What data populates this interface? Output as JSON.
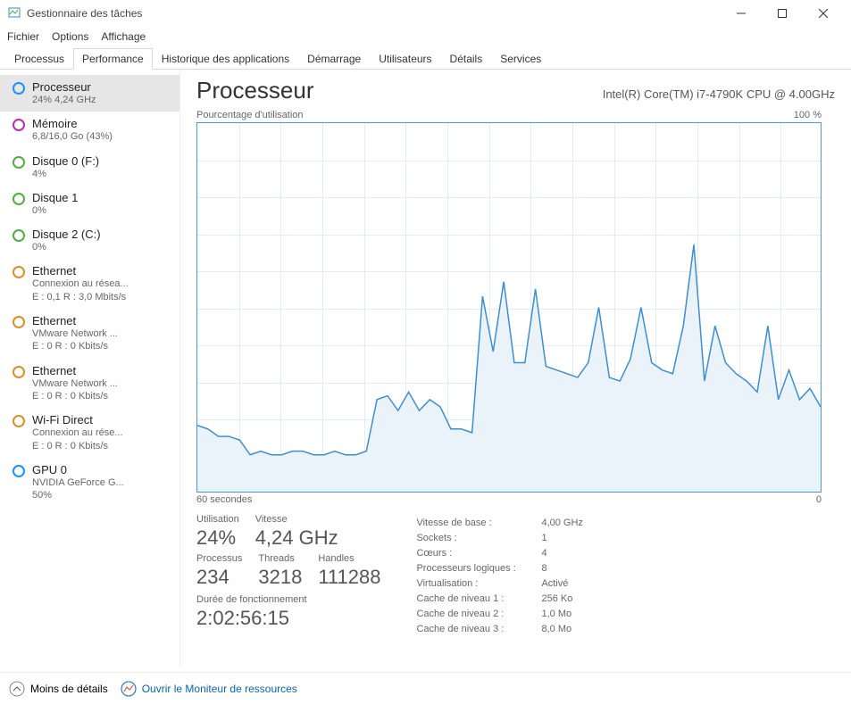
{
  "window": {
    "title": "Gestionnaire des tâches"
  },
  "menu": {
    "file": "Fichier",
    "options": "Options",
    "view": "Affichage"
  },
  "tabs": {
    "processes": "Processus",
    "performance": "Performance",
    "app_history": "Historique des applications",
    "startup": "Démarrage",
    "users": "Utilisateurs",
    "details": "Détails",
    "services": "Services"
  },
  "sidebar": [
    {
      "color": "#1e90ff",
      "title": "Processeur",
      "sub1": "24%  4,24 GHz",
      "sub2": ""
    },
    {
      "color": "#b030b0",
      "title": "Mémoire",
      "sub1": "6,8/16,0 Go (43%)",
      "sub2": ""
    },
    {
      "color": "#55aa44",
      "title": "Disque 0 (F:)",
      "sub1": "4%",
      "sub2": ""
    },
    {
      "color": "#55aa44",
      "title": "Disque 1",
      "sub1": "0%",
      "sub2": ""
    },
    {
      "color": "#55aa44",
      "title": "Disque 2 (C:)",
      "sub1": "0%",
      "sub2": ""
    },
    {
      "color": "#d98e2e",
      "title": "Ethernet",
      "sub1": "Connexion au résea...",
      "sub2": "E : 0,1 R : 3,0 Mbits/s"
    },
    {
      "color": "#d98e2e",
      "title": "Ethernet",
      "sub1": "VMware Network ...",
      "sub2": "E : 0 R : 0 Kbits/s"
    },
    {
      "color": "#d98e2e",
      "title": "Ethernet",
      "sub1": "VMware Network ...",
      "sub2": "E : 0 R : 0 Kbits/s"
    },
    {
      "color": "#d98e2e",
      "title": "Wi-Fi Direct",
      "sub1": "Connexion au rése...",
      "sub2": "E : 0 R : 0 Kbits/s"
    },
    {
      "color": "#1e90ff",
      "title": "GPU 0",
      "sub1": "NVIDIA GeForce G...",
      "sub2": "50%"
    }
  ],
  "main": {
    "heading": "Processeur",
    "model": "Intel(R) Core(TM) i7-4790K CPU @ 4.00GHz",
    "chart_top_left": "Pourcentage d'utilisation",
    "chart_top_right": "100 %",
    "chart_bottom_left": "60 secondes",
    "chart_bottom_right": "0"
  },
  "stats": {
    "utilisation_lbl": "Utilisation",
    "utilisation_val": "24%",
    "vitesse_lbl": "Vitesse",
    "vitesse_val": "4,24 GHz",
    "processus_lbl": "Processus",
    "processus_val": "234",
    "threads_lbl": "Threads",
    "threads_val": "3218",
    "handles_lbl": "Handles",
    "handles_val": "111288",
    "uptime_lbl": "Durée de fonctionnement",
    "uptime_val": "2:02:56:15"
  },
  "details": {
    "base_k": "Vitesse de base :",
    "base_v": "4,00 GHz",
    "sockets_k": "Sockets :",
    "sockets_v": "1",
    "cores_k": "Cœurs :",
    "cores_v": "4",
    "logical_k": "Processeurs logiques :",
    "logical_v": "8",
    "virt_k": "Virtualisation :",
    "virt_v": "Activé",
    "l1_k": "Cache de niveau 1 :",
    "l1_v": "256 Ko",
    "l2_k": "Cache de niveau 2 :",
    "l2_v": "1,0 Mo",
    "l3_k": "Cache de niveau 3 :",
    "l3_v": "8,0 Mo"
  },
  "footer": {
    "less": "Moins de détails",
    "resmon": "Ouvrir le Moniteur de ressources"
  },
  "chart_data": {
    "type": "area",
    "title": "Pourcentage d'utilisation",
    "xlabel": "60 secondes → 0",
    "ylabel": "%",
    "ylim": [
      0,
      100
    ],
    "x": [
      0,
      1,
      2,
      3,
      4,
      5,
      6,
      7,
      8,
      9,
      10,
      11,
      12,
      13,
      14,
      15,
      16,
      17,
      18,
      19,
      20,
      21,
      22,
      23,
      24,
      25,
      26,
      27,
      28,
      29,
      30,
      31,
      32,
      33,
      34,
      35,
      36,
      37,
      38,
      39,
      40,
      41,
      42,
      43,
      44,
      45,
      46,
      47,
      48,
      49,
      50,
      51,
      52,
      53,
      54,
      55,
      56,
      57,
      58,
      59
    ],
    "values": [
      18,
      17,
      15,
      15,
      14,
      10,
      11,
      10,
      10,
      11,
      11,
      10,
      10,
      11,
      10,
      10,
      11,
      25,
      26,
      22,
      27,
      22,
      25,
      23,
      17,
      17,
      16,
      53,
      38,
      57,
      35,
      35,
      55,
      34,
      33,
      32,
      31,
      35,
      50,
      31,
      30,
      36,
      50,
      35,
      33,
      32,
      45,
      67,
      30,
      45,
      35,
      32,
      30,
      27,
      45,
      25,
      33,
      25,
      28,
      23
    ],
    "color": "#3e8ecf"
  }
}
